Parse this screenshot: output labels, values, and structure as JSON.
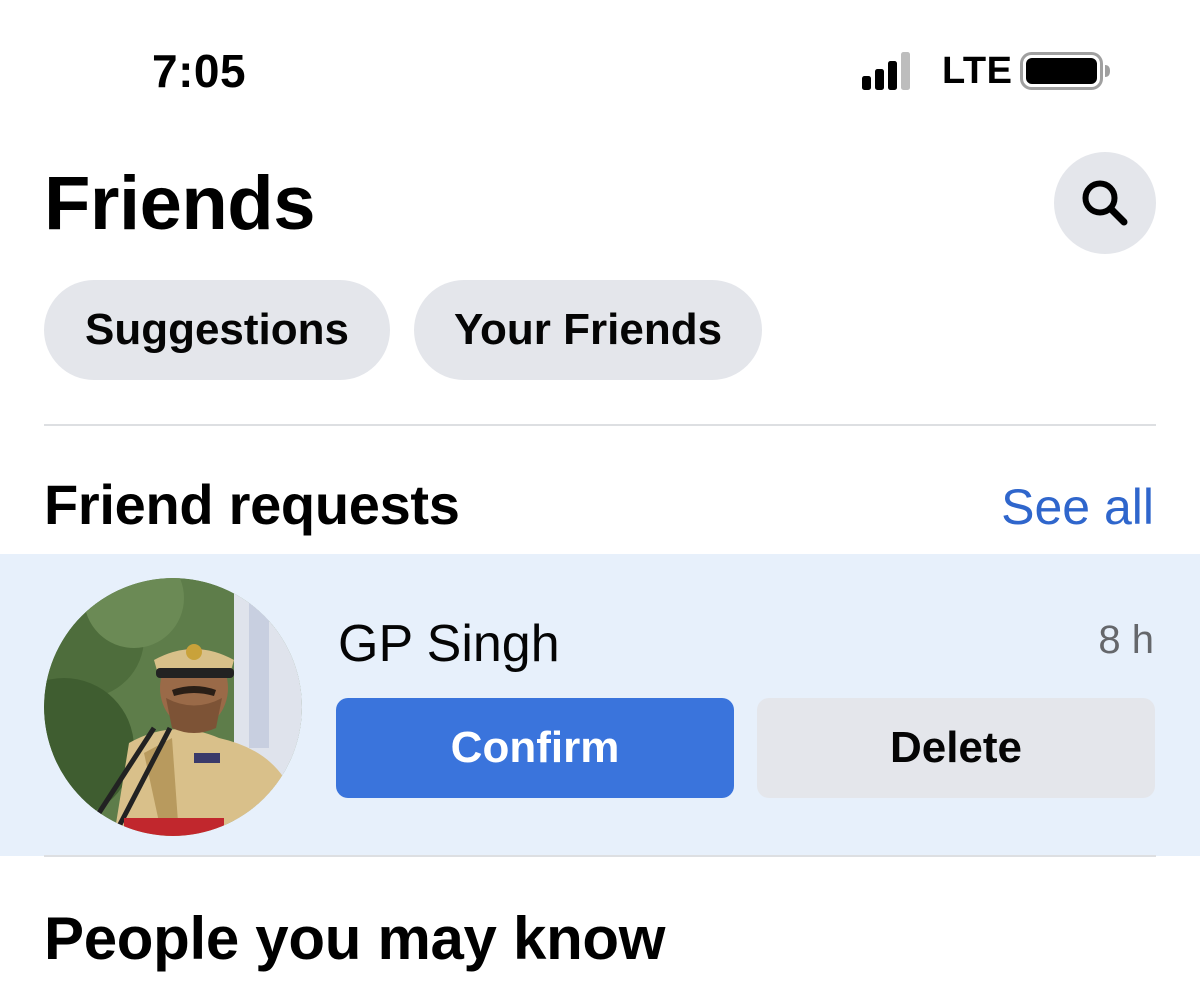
{
  "status_bar": {
    "time": "7:05",
    "network": "LTE",
    "signal_bars": 3,
    "icons": [
      "signal-icon",
      "battery-icon"
    ]
  },
  "header": {
    "title": "Friends",
    "search_icon": "search-icon"
  },
  "tabs": [
    {
      "label": "Suggestions"
    },
    {
      "label": "Your Friends"
    }
  ],
  "friend_requests": {
    "title": "Friend requests",
    "see_all": "See all",
    "items": [
      {
        "name": "GP Singh",
        "time": "8 h",
        "confirm_label": "Confirm",
        "delete_label": "Delete"
      }
    ]
  },
  "people_you_may_know": {
    "title": "People you may know"
  },
  "colors": {
    "accent": "#3a74dc",
    "link": "#2f66cc",
    "chip_bg": "#e4e6eb",
    "card_bg": "#e7f0fb",
    "secondary_text": "#65676b"
  }
}
